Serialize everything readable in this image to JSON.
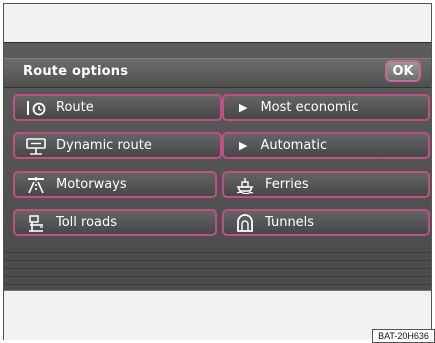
{
  "header": {
    "title": "Route options",
    "ok_label": "OK"
  },
  "options": [
    {
      "label": "Route",
      "icon": "route-clock-icon",
      "value": "Most economic"
    },
    {
      "label": "Dynamic route",
      "icon": "traffic-sign-icon",
      "value": "Automatic"
    }
  ],
  "avoid": [
    {
      "label": "Motorways",
      "icon": "motorway-icon"
    },
    {
      "label": "Ferries",
      "icon": "ferry-icon"
    },
    {
      "label": "Toll roads",
      "icon": "toll-booth-icon"
    },
    {
      "label": "Tunnels",
      "icon": "tunnel-icon"
    }
  ],
  "figure_code": "BAT-20H636",
  "colors": {
    "button_border": "#c04f86",
    "screen_bg": "#505050",
    "text": "#ffffff"
  }
}
